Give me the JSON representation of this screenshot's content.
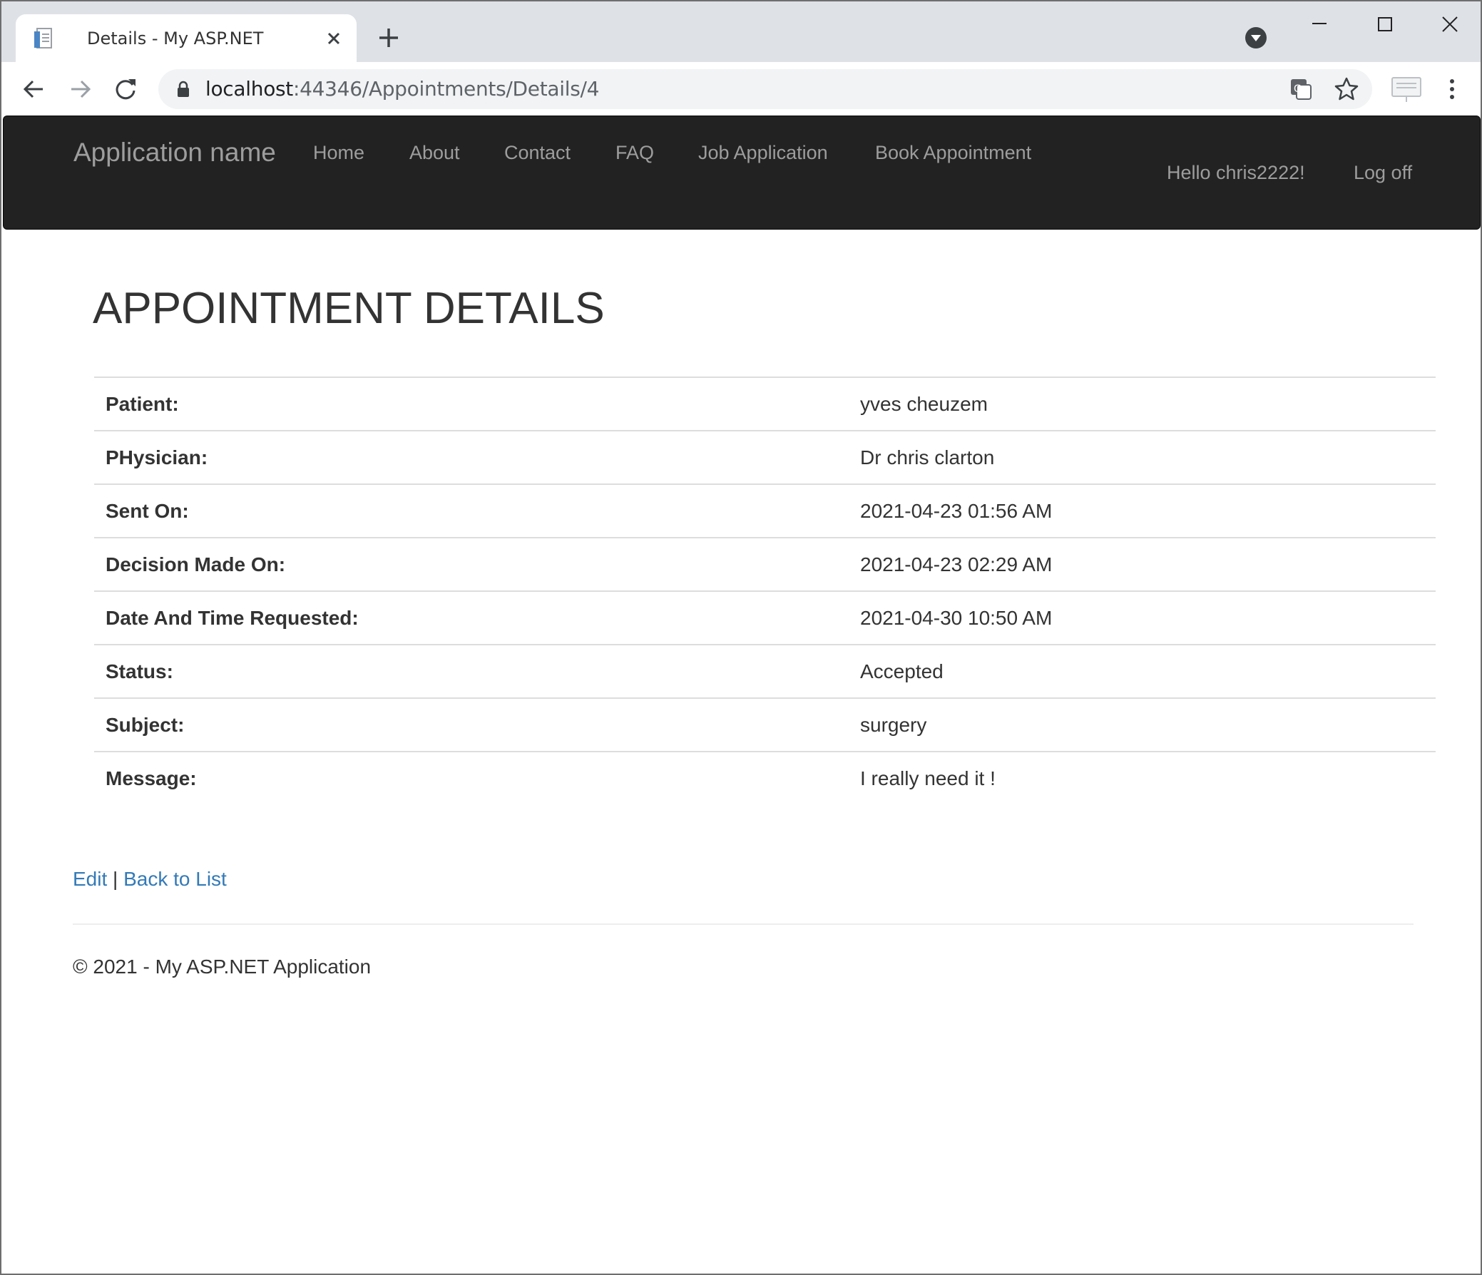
{
  "browser": {
    "tab_title": "Details - My ASP.NET Application",
    "url_host": "localhost",
    "url_path": ":44346/Appointments/Details/4"
  },
  "navbar": {
    "brand": "Application name",
    "items": [
      {
        "label": "Home"
      },
      {
        "label": "About"
      },
      {
        "label": "Contact"
      },
      {
        "label": "FAQ"
      },
      {
        "label": "Job Application"
      },
      {
        "label": "Book Appointment"
      }
    ],
    "greeting": "Hello chris2222!",
    "logoff": "Log off"
  },
  "page": {
    "title": "APPOINTMENT DETAILS",
    "rows": [
      {
        "label": "Patient:",
        "value": "yves cheuzem"
      },
      {
        "label": "PHysician:",
        "value": "Dr chris clarton"
      },
      {
        "label": "Sent On:",
        "value": "2021-04-23 01:56 AM"
      },
      {
        "label": "Decision Made On:",
        "value": "2021-04-23 02:29 AM"
      },
      {
        "label": "Date And Time Requested:",
        "value": "2021-04-30 10:50 AM"
      },
      {
        "label": "Status:",
        "value": "Accepted"
      },
      {
        "label": "Subject:",
        "value": "surgery"
      },
      {
        "label": "Message:",
        "value": "I really need it !"
      }
    ],
    "edit_link": "Edit",
    "separator": "|",
    "back_link": "Back to List"
  },
  "footer": {
    "text": "© 2021 - My ASP.NET Application"
  },
  "colors": {
    "navbar_bg": "#222222",
    "nav_text": "#9d9d9d",
    "link": "#337ab7",
    "chrome_tabstrip": "#dee1e6"
  },
  "icons": [
    "page-favicon-icon",
    "close-icon",
    "plus-icon",
    "profile-dropdown-icon",
    "minimize-icon",
    "maximize-icon",
    "window-close-icon",
    "back-arrow-icon",
    "forward-arrow-icon",
    "reload-icon",
    "lock-icon",
    "translate-icon",
    "star-icon",
    "cast-icon",
    "more-vert-icon"
  ]
}
